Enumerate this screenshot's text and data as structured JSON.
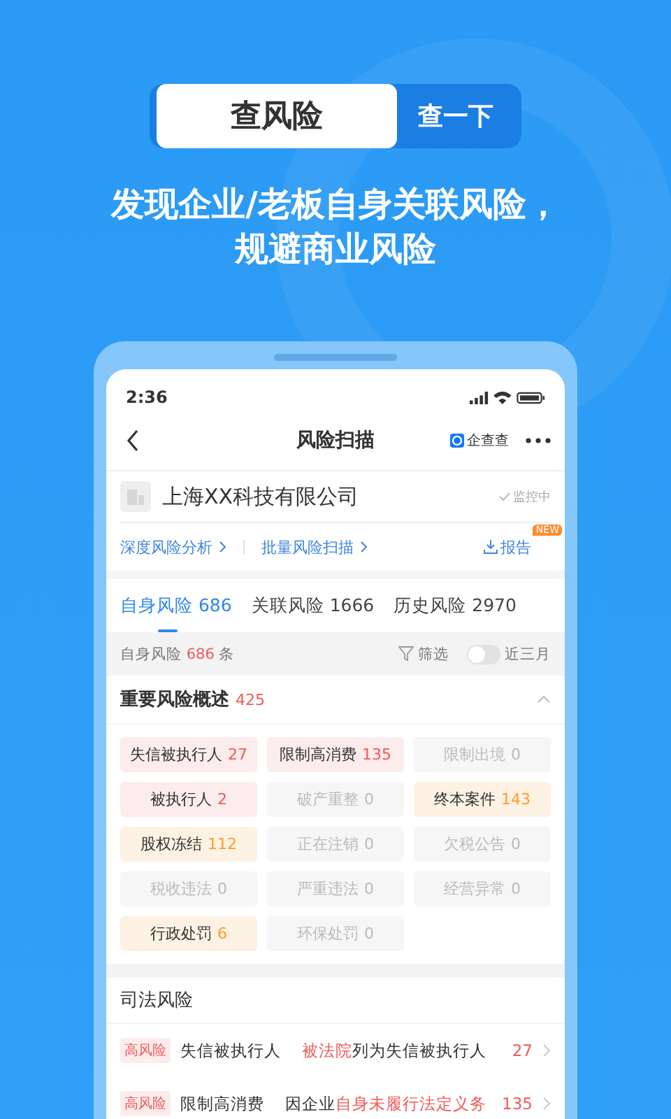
{
  "search": {
    "value": "查风险",
    "button": "查一下"
  },
  "headline": [
    "发现企业/老板自身关联风险，",
    "规避商业风险"
  ],
  "phone": {
    "status_bar": {
      "time": "2:36"
    },
    "nav": {
      "title": "风险扫描",
      "brand": "企查查"
    },
    "company": {
      "name": "上海XX科技有限公司",
      "monitor": "监控中"
    },
    "links": [
      {
        "label": "深度风险分析",
        "kind": "arrow"
      },
      {
        "label": "批量风险扫描",
        "kind": "arrow"
      },
      {
        "label": "报告",
        "kind": "download",
        "badge": "NEW"
      }
    ],
    "tabs": [
      {
        "label": "自身风险",
        "count": "686",
        "selected": true
      },
      {
        "label": "关联风险",
        "count": "1666",
        "selected": false
      },
      {
        "label": "历史风险",
        "count": "2970",
        "selected": false
      }
    ],
    "filter": {
      "prefix": "自身风险",
      "count": "686",
      "suffix": "条",
      "filter_label": "筛选",
      "toggle_label": "近三月",
      "toggle_on": false
    },
    "overview": {
      "title": "重要风险概述",
      "count": "425",
      "expanded": true,
      "chips": [
        {
          "label": "失信被执行人",
          "count": "27",
          "kind": "high"
        },
        {
          "label": "限制高消费",
          "count": "135",
          "kind": "high"
        },
        {
          "label": "限制出境",
          "count": "0",
          "kind": "none"
        },
        {
          "label": "被执行人",
          "count": "2",
          "kind": "high"
        },
        {
          "label": "破产重整",
          "count": "0",
          "kind": "none"
        },
        {
          "label": "终本案件",
          "count": "143",
          "kind": "warn"
        },
        {
          "label": "股权冻结",
          "count": "112",
          "kind": "warn"
        },
        {
          "label": "正在注销",
          "count": "0",
          "kind": "none"
        },
        {
          "label": "欠税公告",
          "count": "0",
          "kind": "none"
        },
        {
          "label": "税收违法",
          "count": "0",
          "kind": "none"
        },
        {
          "label": "严重违法",
          "count": "0",
          "kind": "none"
        },
        {
          "label": "经营异常",
          "count": "0",
          "kind": "none"
        },
        {
          "label": "行政处罚",
          "count": "6",
          "kind": "warn"
        },
        {
          "label": "环保处罚",
          "count": "0",
          "kind": "none"
        }
      ]
    },
    "judicial": {
      "title": "司法风险",
      "rows": [
        {
          "tag": "高风险",
          "name": "失信被执行人",
          "highlight": "被法院",
          "rest": "列为失信被执行人",
          "count": "27"
        },
        {
          "tag": "高风险",
          "name": "限制高消费",
          "lead": "因企业",
          "highlight": "自身未履行法定义务",
          "count": "135"
        }
      ]
    }
  }
}
